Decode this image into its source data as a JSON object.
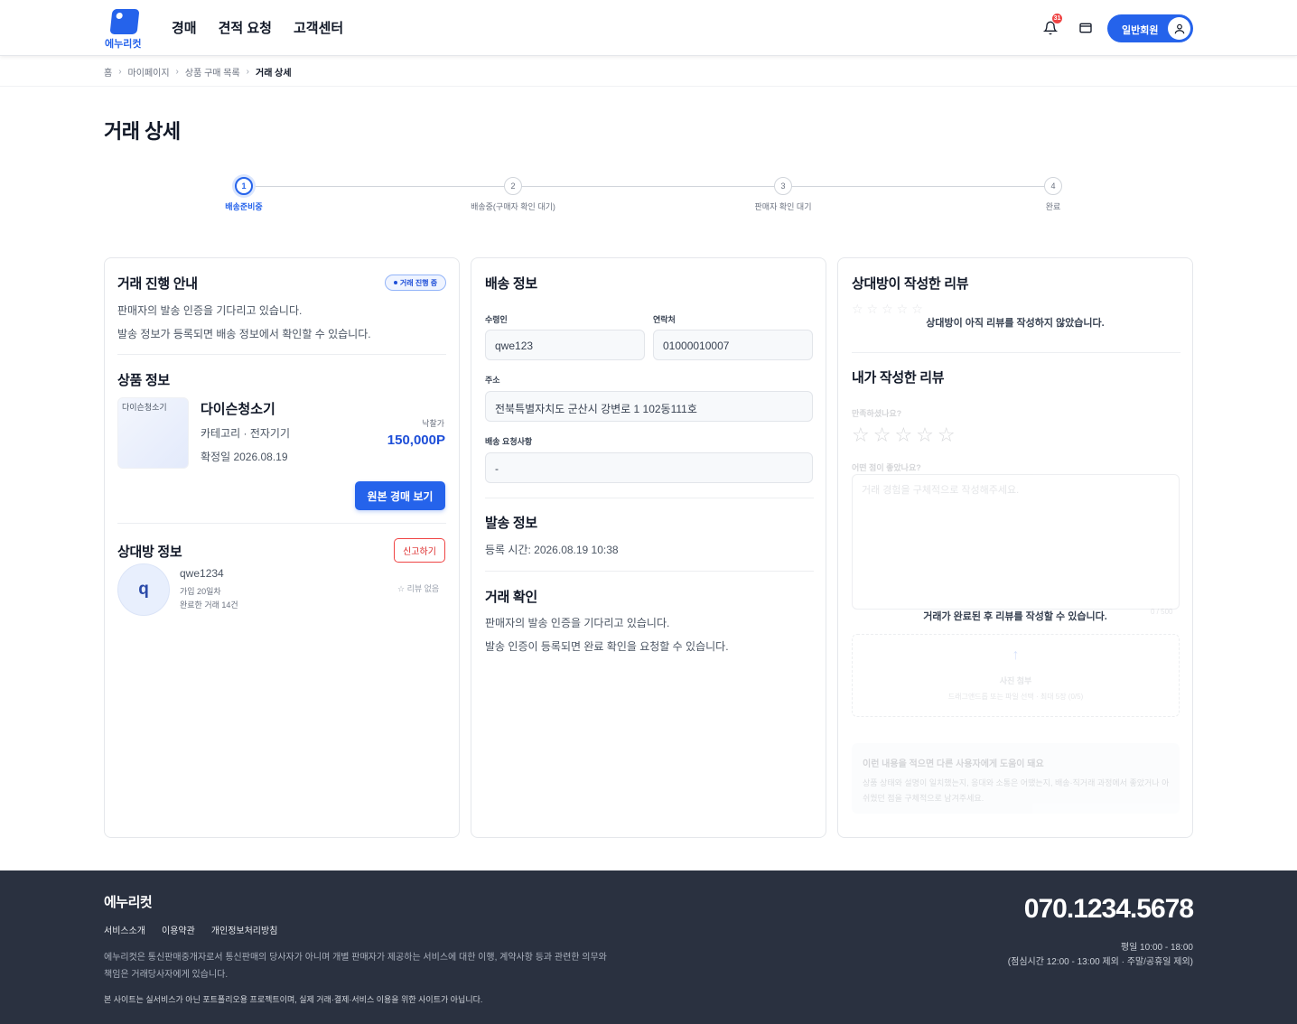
{
  "header": {
    "logo_text": "에누리컷",
    "nav": [
      "경매",
      "견적 요청",
      "고객센터"
    ],
    "notification_count": "31",
    "member_label": "일반회원"
  },
  "breadcrumb": [
    "홈",
    "마이페이지",
    "상품 구매 목록",
    "거래 상세"
  ],
  "page_title": "거래 상세",
  "steps": [
    {
      "num": "1",
      "label": "배송준비중",
      "active": true
    },
    {
      "num": "2",
      "label": "배송중(구매자 확인 대기)",
      "active": false
    },
    {
      "num": "3",
      "label": "판매자 확인 대기",
      "active": false
    },
    {
      "num": "4",
      "label": "완료",
      "active": false
    }
  ],
  "progress": {
    "title": "거래 진행 안내",
    "badge": "거래 진행 중",
    "line1": "판매자의 발송 인증을 기다리고 있습니다.",
    "line2": "발송 정보가 등록되면 배송 정보에서 확인할 수 있습니다."
  },
  "product": {
    "section_title": "상품 정보",
    "image_alt": "다이슨청소기",
    "name": "다이슨청소기",
    "category": "카테고리 · 전자기기",
    "confirmed": "확정일 2026.08.19",
    "price_label": "낙찰가",
    "price": "150,000P",
    "button": "원본 경매 보기"
  },
  "counterpart": {
    "section_title": "상대방 정보",
    "report_button": "신고하기",
    "avatar_letter": "q",
    "username": "qwe1234",
    "joined": "가입 20일차",
    "completed": "완료한 거래 14건",
    "review_status": "리뷰 없음"
  },
  "shipping": {
    "title": "배송 정보",
    "recipient_label": "수령인",
    "recipient": "qwe123",
    "contact_label": "연락처",
    "contact": "01000010007",
    "address_label": "주소",
    "address": "전북특별자치도 군산시 강변로 1 102동111호",
    "request_label": "배송 요청사항",
    "request": "-",
    "dispatch_title": "발송 정보",
    "dispatch_time": "등록 시간: 2026.08.19 10:38",
    "confirm_title": "거래 확인",
    "confirm_line1": "판매자의 발송 인증을 기다리고 있습니다.",
    "confirm_line2": "발송 인증이 등록되면 완료 확인을 요청할 수 있습니다."
  },
  "reviews": {
    "their_title": "상대방이 작성한 리뷰",
    "their_empty": "상대방이 아직 리뷰를 작성하지 않았습니다.",
    "mine_title": "내가 작성한 리뷰",
    "satisfaction_q": "만족하셨나요?",
    "experience_q": "어떤 점이 좋았나요?",
    "textarea_placeholder": "거래 경험을 구체적으로 작성해주세요.",
    "char_count": "0 / 500",
    "locked_message": "거래가 완료된 후 리뷰를 작성할 수 있습니다.",
    "photo_title": "사진 첨부",
    "photo_hint": "드래그앤드롭 또는 파일 선택 · 최대 5장 (0/5)",
    "tip_title": "이런 내용을 적으면 다른 사용자에게 도움이 돼요",
    "tip_body": "상품 상태와 설명이 일치했는지, 응대와 소통은 어땠는지, 배송·직거래 과정에서 좋았거나 아쉬웠던 점을 구체적으로 남겨주세요."
  },
  "footer": {
    "logo": "에누리컷",
    "links": [
      "서비스소개",
      "이용약관",
      "개인정보처리방침"
    ],
    "desc": "에누리컷은 통신판매중개자로서 통신판매의 당사자가 아니며 개별 판매자가 제공하는 서비스에 대한 이행, 계약사항 등과 관련한 의무와 책임은 거래당사자에게 있습니다.",
    "note": "본 사이트는 실서비스가 아닌 포트폴리오용 프로젝트이며, 실제 거래·결제·서비스 이용을 위한 사이트가 아닙니다.",
    "phone": "070.1234.5678",
    "hours1": "평일 10:00 - 18:00",
    "hours2": "(점심시간 12:00 - 13:00 제외 · 주말/공휴일 제외)"
  },
  "colors": {
    "accent": "#2563eb",
    "danger": "#ef4444",
    "footer_bg": "#2a3140"
  }
}
